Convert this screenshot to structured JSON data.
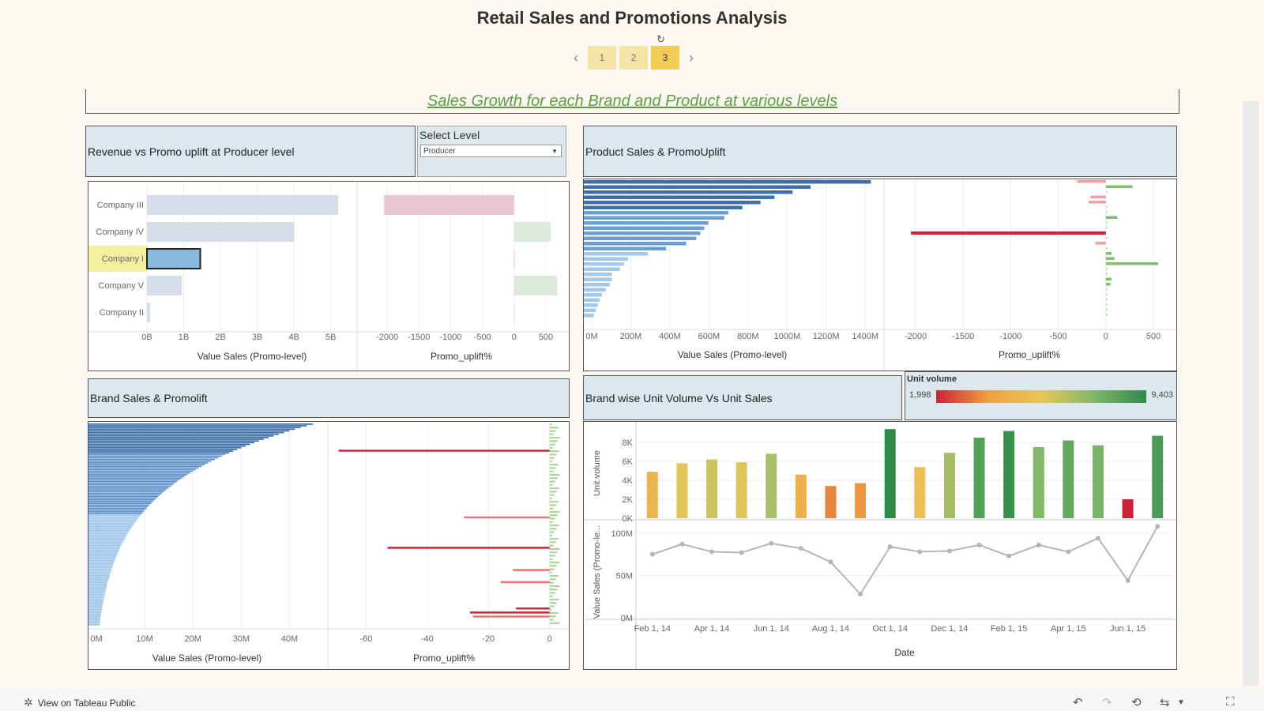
{
  "page": {
    "title": "Retail Sales and Promotions Analysis",
    "subtitle": "Sales Growth for each Brand and Product at various levels",
    "pages": [
      "1",
      "2",
      "3"
    ],
    "active_page": "3",
    "reset_icon": "reset-icon"
  },
  "filter": {
    "label": "Select Level",
    "value": "Producer"
  },
  "headers": {
    "producer": "Revenue vs Promo uplift  at Producer level",
    "product": "Product Sales & PromoUplift",
    "brand": "Brand Sales & Promolift",
    "unit": "Brand wise Unit Volume Vs Unit Sales"
  },
  "legend": {
    "title": "Unit volume",
    "min": "1,998",
    "max": "9,403"
  },
  "footer": {
    "link": "View on Tableau Public"
  },
  "colors": {
    "accent": "#f1cb55",
    "green": "#5c9e44",
    "blue": "#4a7fb5",
    "red": "#c9243a"
  },
  "chart_data": [
    {
      "type": "bar",
      "name": "producer-sales",
      "categories": [
        "Company III",
        "Company IV",
        "Company I",
        "Company V",
        "Company II"
      ],
      "values": [
        5.2,
        4.0,
        1.45,
        0.95,
        0.08
      ],
      "highlighted": "Company I",
      "xlabel": "Value Sales (Promo-level)",
      "ticks": [
        "0B",
        "1B",
        "2B",
        "3B",
        "4B",
        "5B"
      ],
      "xlim": [
        0,
        5.5
      ]
    },
    {
      "type": "bar",
      "name": "producer-uplift",
      "categories": [
        "Company III",
        "Company IV",
        "Company I",
        "Company V",
        "Company II"
      ],
      "values": [
        -2050,
        580,
        -5,
        680,
        0
      ],
      "xlabel": "Promo_uplift%",
      "ticks": [
        "-2000",
        "-1500",
        "-1000",
        "-500",
        "0",
        "500"
      ],
      "xlim": [
        -2400,
        700
      ]
    },
    {
      "type": "bar",
      "name": "product-sales",
      "values": [
        1430,
        1130,
        1040,
        950,
        880,
        790,
        720,
        700,
        620,
        600,
        580,
        560,
        510,
        410,
        320,
        220,
        200,
        180,
        140,
        140,
        130,
        110,
        90,
        80,
        70,
        60,
        50
      ],
      "xlabel": "Value Sales (Promo-level)",
      "ticks": [
        "0M",
        "200M",
        "400M",
        "600M",
        "800M",
        "1000M",
        "1200M",
        "1400M"
      ],
      "xlim": [
        0,
        1480
      ]
    },
    {
      "type": "bar",
      "name": "product-uplift",
      "values": [
        -300,
        280,
        0,
        -160,
        -180,
        0,
        0,
        120,
        0,
        0,
        -2050,
        0,
        -110,
        0,
        60,
        90,
        550,
        0,
        0,
        60,
        50,
        0,
        0,
        0,
        0,
        0,
        0
      ],
      "xlabel": "Promo_uplift%",
      "ticks": [
        "-2000",
        "-1500",
        "-1000",
        "-500",
        "0",
        "500"
      ],
      "xlim": [
        -2200,
        700
      ]
    },
    {
      "type": "bar",
      "name": "brand-sales",
      "xlabel": "Value Sales (Promo-level)",
      "ticks": [
        "0M",
        "10M",
        "20M",
        "30M",
        "40M"
      ],
      "xlim": [
        0,
        45
      ],
      "decay_max": 42,
      "bar_count": 120
    },
    {
      "type": "bar",
      "name": "brand-uplift",
      "xlabel": "Promo_uplift%",
      "ticks": [
        "-60",
        "-40",
        "-20",
        "0"
      ],
      "xlim": [
        -72,
        5
      ],
      "highlight_bars": [
        {
          "pos": 0.13,
          "value": -69,
          "color": "#c9243a"
        },
        {
          "pos": 0.46,
          "value": -28,
          "color": "#e57373"
        },
        {
          "pos": 0.61,
          "value": -53,
          "color": "#c9243a"
        },
        {
          "pos": 0.72,
          "value": -12,
          "color": "#e57373"
        },
        {
          "pos": 0.78,
          "value": -16,
          "color": "#e57373"
        },
        {
          "pos": 0.93,
          "value": -26,
          "color": "#c9243a"
        },
        {
          "pos": 0.95,
          "value": -25,
          "color": "#e57373"
        },
        {
          "pos": 0.91,
          "value": -11,
          "color": "#c9243a"
        }
      ]
    },
    {
      "type": "bar",
      "name": "unit-volume",
      "ylabel": "Unit volume",
      "categories": [
        "Feb 1, 14",
        "Mar 1, 14",
        "Apr 1, 14",
        "May 1, 14",
        "Jun 1, 14",
        "Jul 1, 14",
        "Aug 1, 14",
        "Sep 1, 14",
        "Oct 1, 14",
        "Nov 1, 14",
        "Dec 1, 14",
        "Jan 1, 15",
        "Feb 1, 15",
        "Mar 1, 15",
        "Apr 1, 15",
        "May 1, 15",
        "Jun 1, 15",
        "Jul 1, 15"
      ],
      "values": [
        4900,
        5800,
        6200,
        5900,
        6800,
        4600,
        3400,
        3700,
        9400,
        5400,
        6900,
        8500,
        9200,
        7500,
        8200,
        7700,
        1998,
        8700
      ],
      "yticks": [
        "0K",
        "2K",
        "4K",
        "6K",
        "8K"
      ],
      "ylim": [
        0,
        9500
      ]
    },
    {
      "type": "line",
      "name": "value-sales",
      "ylabel": "Value Sales (Promo-le...",
      "xlabel": "Date",
      "values": [
        75,
        87,
        78,
        77,
        88,
        82,
        66,
        28,
        84,
        78,
        79,
        86,
        73,
        86,
        78,
        94,
        44,
        108
      ],
      "yticks": [
        "0M",
        "50M",
        "100M"
      ],
      "ylim": [
        0,
        112
      ],
      "xticks": [
        "Feb 1, 14",
        "Apr 1, 14",
        "Jun 1, 14",
        "Aug 1, 14",
        "Oct 1, 14",
        "Dec 1, 14",
        "Feb 1, 15",
        "Apr 1, 15",
        "Jun 1, 15"
      ]
    }
  ]
}
